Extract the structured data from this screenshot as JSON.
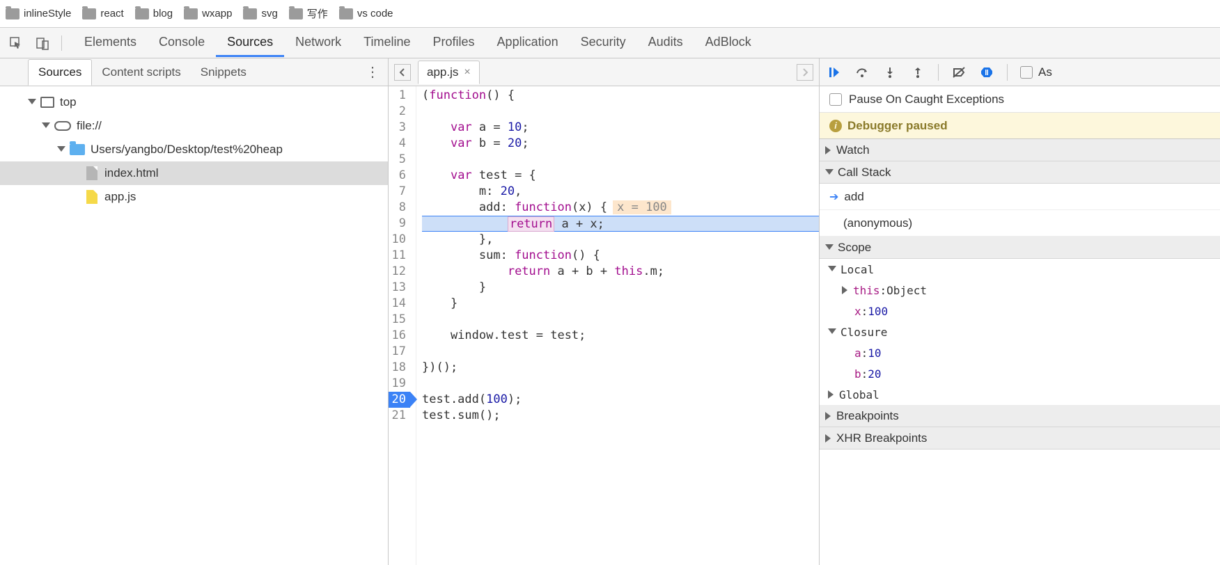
{
  "bookmarks": [
    "inlineStyle",
    "react",
    "blog",
    "wxapp",
    "svg",
    "写作",
    "vs code"
  ],
  "devtools_tabs": [
    "Elements",
    "Console",
    "Sources",
    "Network",
    "Timeline",
    "Profiles",
    "Application",
    "Security",
    "Audits",
    "AdBlock"
  ],
  "devtools_active": "Sources",
  "left": {
    "tabs": [
      "Sources",
      "Content scripts",
      "Snippets"
    ],
    "active": "Sources",
    "tree": {
      "top": "top",
      "origin": "file://",
      "folder": "Users/yangbo/Desktop/test%20heap",
      "files": [
        "index.html",
        "app.js"
      ],
      "selected": "index.html"
    }
  },
  "editor": {
    "tab": "app.js",
    "breakpoint_line": 20,
    "exec_line": 9,
    "inline_hint": "x = 100",
    "lines": [
      {
        "tokens": [
          [
            "p",
            "("
          ],
          [
            "kw",
            "function"
          ],
          [
            "p",
            "() {"
          ]
        ]
      },
      {
        "tokens": []
      },
      {
        "tokens": [
          [
            "sp",
            "    "
          ],
          [
            "kw",
            "var"
          ],
          [
            "p",
            " a = "
          ],
          [
            "num",
            "10"
          ],
          [
            "p",
            ";"
          ]
        ]
      },
      {
        "tokens": [
          [
            "sp",
            "    "
          ],
          [
            "kw",
            "var"
          ],
          [
            "p",
            " b = "
          ],
          [
            "num",
            "20"
          ],
          [
            "p",
            ";"
          ]
        ]
      },
      {
        "tokens": []
      },
      {
        "tokens": [
          [
            "sp",
            "    "
          ],
          [
            "kw",
            "var"
          ],
          [
            "p",
            " test = {"
          ]
        ]
      },
      {
        "tokens": [
          [
            "sp",
            "        "
          ],
          [
            "p",
            "m: "
          ],
          [
            "num",
            "20"
          ],
          [
            "p",
            ","
          ]
        ]
      },
      {
        "tokens": [
          [
            "sp",
            "        "
          ],
          [
            "p",
            "add: "
          ],
          [
            "kw",
            "function"
          ],
          [
            "p",
            "(x) {"
          ]
        ],
        "hint": true
      },
      {
        "tokens": [
          [
            "sp",
            "            "
          ],
          [
            "ret",
            "return"
          ],
          [
            "p",
            " a + x;"
          ]
        ],
        "exec": true
      },
      {
        "tokens": [
          [
            "sp",
            "        "
          ],
          [
            "p",
            "},"
          ]
        ]
      },
      {
        "tokens": [
          [
            "sp",
            "        "
          ],
          [
            "p",
            "sum: "
          ],
          [
            "kw",
            "function"
          ],
          [
            "p",
            "() {"
          ]
        ]
      },
      {
        "tokens": [
          [
            "sp",
            "            "
          ],
          [
            "kw",
            "return"
          ],
          [
            "p",
            " a + b + "
          ],
          [
            "kw",
            "this"
          ],
          [
            "p",
            ".m;"
          ]
        ]
      },
      {
        "tokens": [
          [
            "sp",
            "        "
          ],
          [
            "p",
            "}"
          ]
        ]
      },
      {
        "tokens": [
          [
            "sp",
            "    "
          ],
          [
            "p",
            "}"
          ]
        ]
      },
      {
        "tokens": []
      },
      {
        "tokens": [
          [
            "sp",
            "    "
          ],
          [
            "p",
            "window.test = test;"
          ]
        ]
      },
      {
        "tokens": []
      },
      {
        "tokens": [
          [
            "p",
            "})();"
          ]
        ]
      },
      {
        "tokens": []
      },
      {
        "tokens": [
          [
            "p",
            "test.add("
          ],
          [
            "num",
            "100"
          ],
          [
            "p",
            ");"
          ]
        ],
        "bp": true
      },
      {
        "tokens": [
          [
            "p",
            "test.sum();"
          ]
        ]
      }
    ]
  },
  "right": {
    "pause_exceptions": "Pause On Caught Exceptions",
    "status": "Debugger paused",
    "sections": {
      "watch": "Watch",
      "callstack": "Call Stack",
      "scope": "Scope",
      "breakpoints": "Breakpoints",
      "xhr": "XHR Breakpoints"
    },
    "callstack": [
      {
        "name": "add",
        "current": true
      },
      {
        "name": "(anonymous)",
        "current": false
      }
    ],
    "scope": {
      "local": {
        "label": "Local",
        "this_key": "this",
        "this_val": "Object",
        "x_key": "x",
        "x_val": "100"
      },
      "closure": {
        "label": "Closure",
        "a_key": "a",
        "a_val": "10",
        "b_key": "b",
        "b_val": "20"
      },
      "global": "Global"
    },
    "async_label": "As"
  }
}
